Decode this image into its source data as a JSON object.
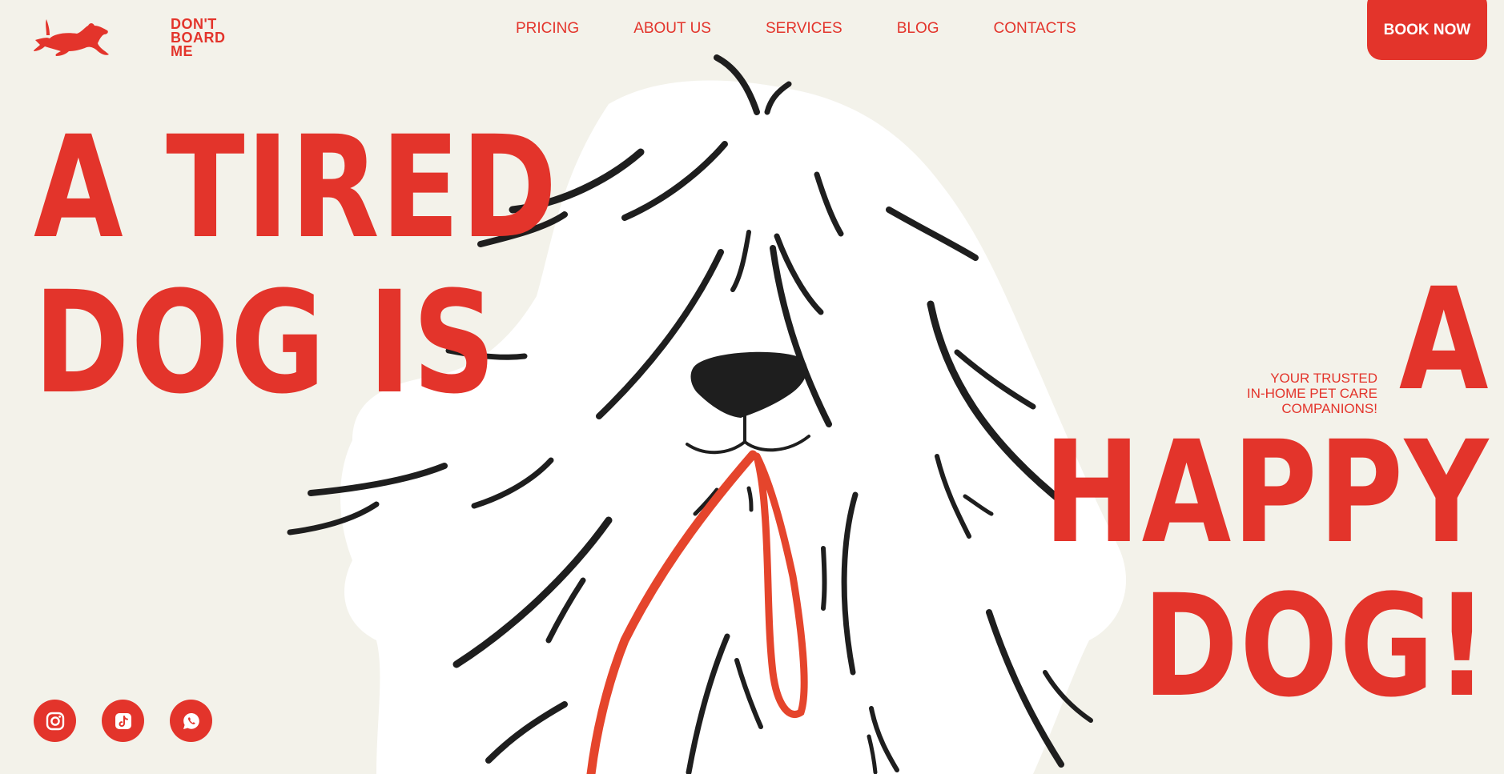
{
  "brand": {
    "logo_lines": [
      "DON'T",
      "BOARD",
      "ME"
    ],
    "accent_color": "#e3342b",
    "background_color": "#f3f2ea",
    "logo_icon": "running-dachshund-icon"
  },
  "nav": {
    "items": [
      "PRICING",
      "ABOUT US",
      "SERVICES",
      "BLOG",
      "CONTACTS"
    ]
  },
  "cta": {
    "label": "BOOK NOW"
  },
  "hero": {
    "headline_left": [
      "A TIRED",
      "DOG IS"
    ],
    "headline_right": [
      "A",
      "HAPPY",
      "DOG!"
    ],
    "tagline": [
      "YOUR TRUSTED",
      "IN-HOME PET CARE",
      "COMPANIONS!"
    ],
    "illustration": "shaggy-white-dog-with-red-leash"
  },
  "socials": [
    {
      "icon": "instagram-icon"
    },
    {
      "icon": "tiktok-icon"
    },
    {
      "icon": "whatsapp-icon"
    }
  ]
}
